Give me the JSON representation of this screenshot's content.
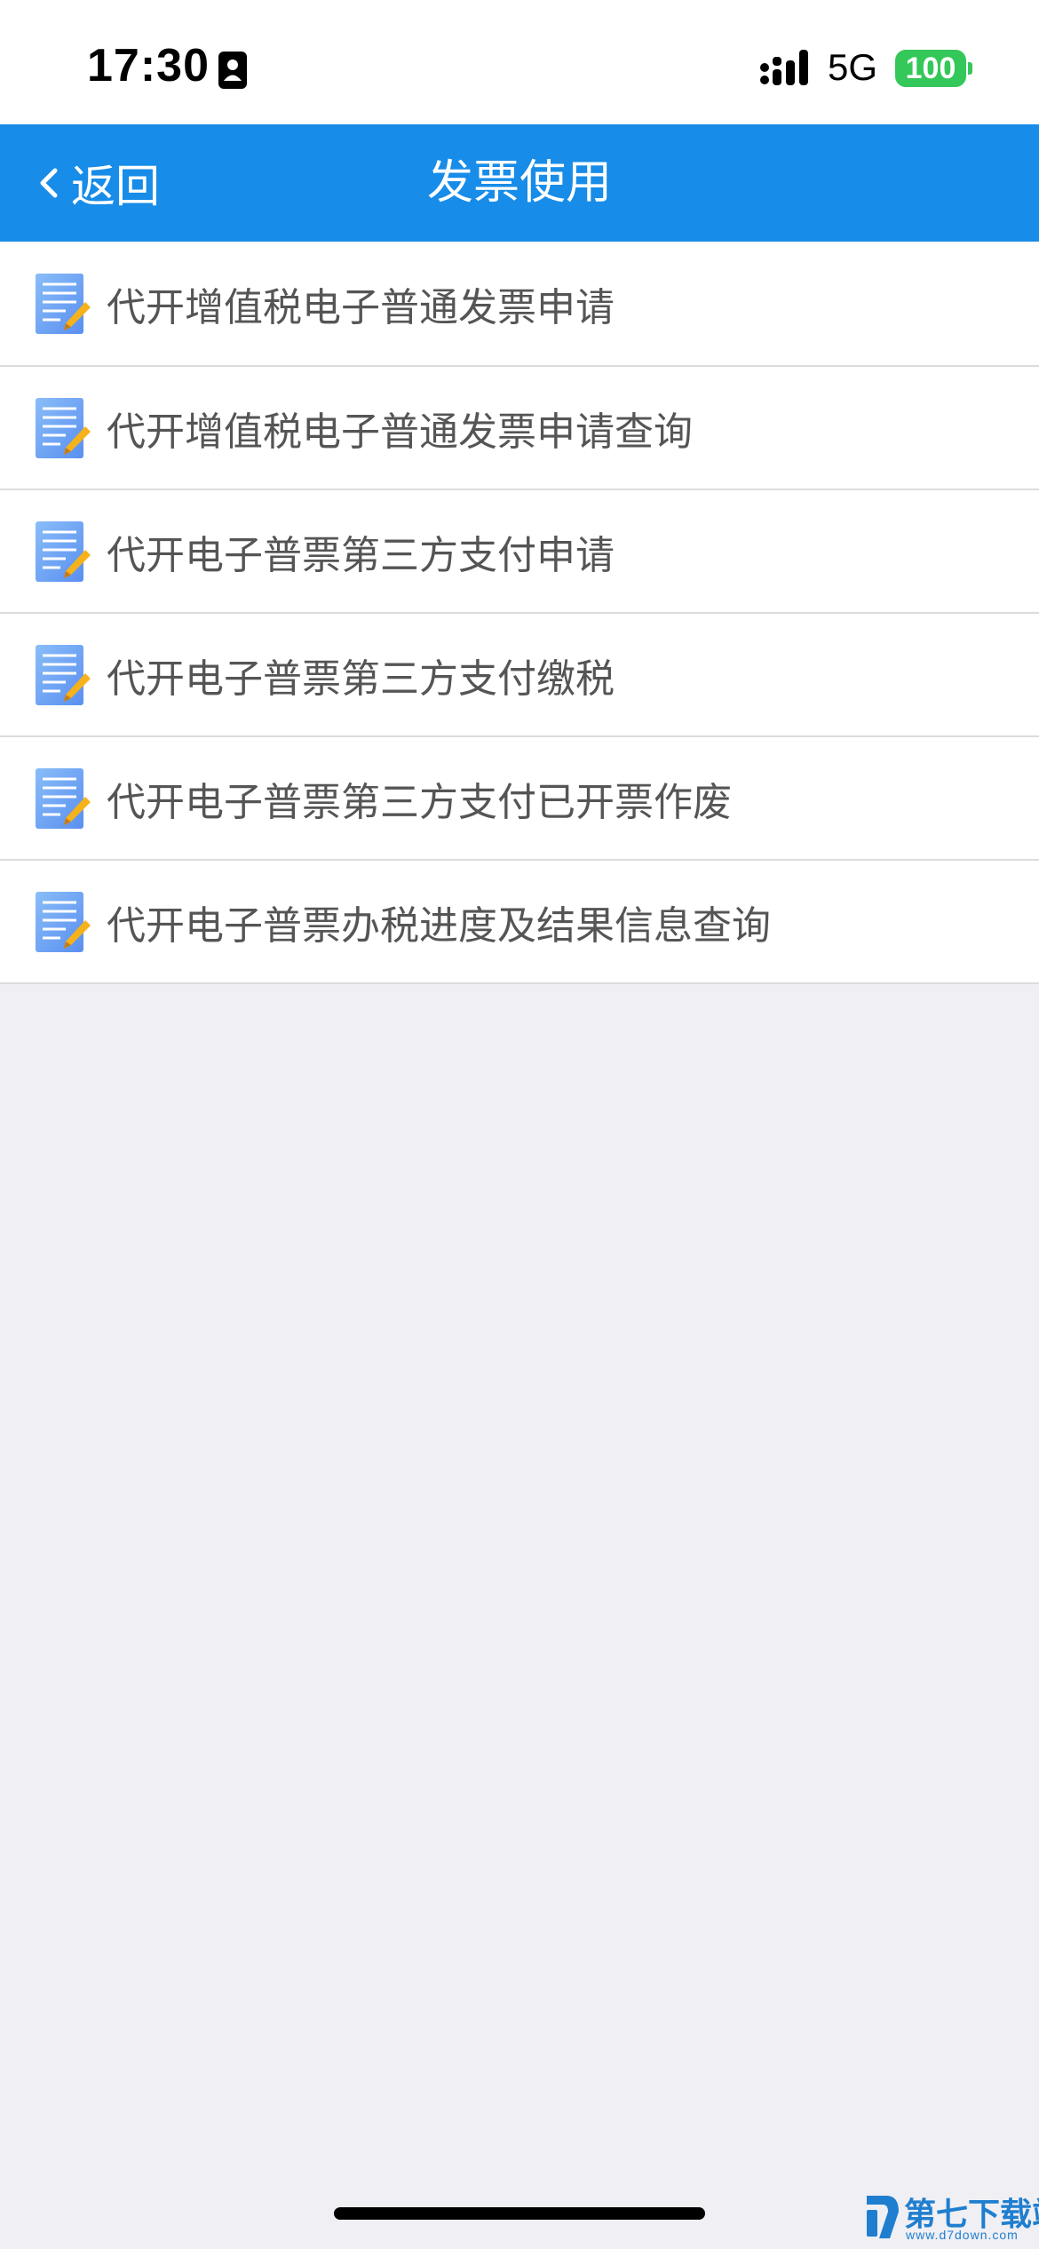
{
  "status_bar": {
    "time": "17:30",
    "network": "5G",
    "battery": "100"
  },
  "nav": {
    "back_label": "返回",
    "title": "发票使用"
  },
  "menu": {
    "items": [
      {
        "label": "代开增值税电子普通发票申请",
        "icon": "document-pencil-icon"
      },
      {
        "label": "代开增值税电子普通发票申请查询",
        "icon": "document-pencil-icon"
      },
      {
        "label": "代开电子普票第三方支付申请",
        "icon": "document-pencil-icon"
      },
      {
        "label": "代开电子普票第三方支付缴税",
        "icon": "document-pencil-icon"
      },
      {
        "label": "代开电子普票第三方支付已开票作废",
        "icon": "document-pencil-icon"
      },
      {
        "label": "代开电子普票办税进度及结果信息查询",
        "icon": "document-pencil-icon"
      }
    ]
  },
  "watermark": {
    "text": "第七下载站",
    "url": "www.d7down.com"
  },
  "colors": {
    "nav_background": "#178ce8",
    "page_background": "#efeff4",
    "battery_green": "#34c759",
    "item_text": "#555555"
  }
}
